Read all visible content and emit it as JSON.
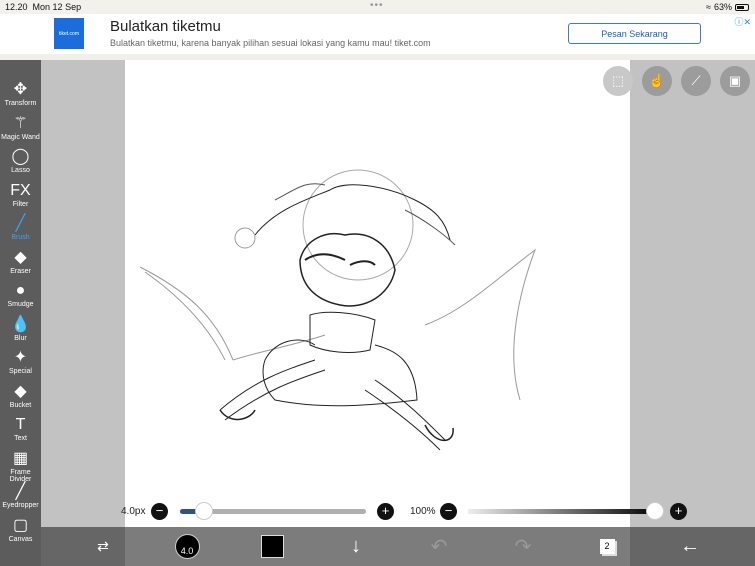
{
  "status": {
    "time": "12.20",
    "date": "Mon 12 Sep",
    "battery": "63%"
  },
  "ad": {
    "logo": "tiket.com",
    "title": "Bulatkan tiketmu",
    "subtitle": "Bulatkan tiketmu, karena banyak pilihan sesuai lokasi yang kamu mau! tiket.com",
    "button": "Pesan Sekarang"
  },
  "tools": [
    {
      "label": "Transform",
      "icon": "✥"
    },
    {
      "label": "Magic Wand",
      "icon": "⚚"
    },
    {
      "label": "Lasso",
      "icon": "◯"
    },
    {
      "label": "Filter",
      "icon": "FX"
    },
    {
      "label": "Brush",
      "icon": "╱"
    },
    {
      "label": "Eraser",
      "icon": "◆"
    },
    {
      "label": "Smudge",
      "icon": "●"
    },
    {
      "label": "Blur",
      "icon": "💧"
    },
    {
      "label": "Special",
      "icon": "✦"
    },
    {
      "label": "Bucket",
      "icon": "◆"
    },
    {
      "label": "Text",
      "icon": "T"
    },
    {
      "label": "Frame Divider",
      "icon": "▦"
    },
    {
      "label": "Eyedropper",
      "icon": "╱"
    },
    {
      "label": "Canvas",
      "icon": "▢"
    }
  ],
  "active_tool": "Brush",
  "brush": {
    "size": "4.0px",
    "size_fraction": 0.1,
    "opacity": "100%",
    "opacity_fraction": 1.0,
    "size_badge": "4.0"
  },
  "layers": {
    "count": "2"
  },
  "colors": {
    "current": "#000000",
    "accent": "#3fa0f0"
  }
}
